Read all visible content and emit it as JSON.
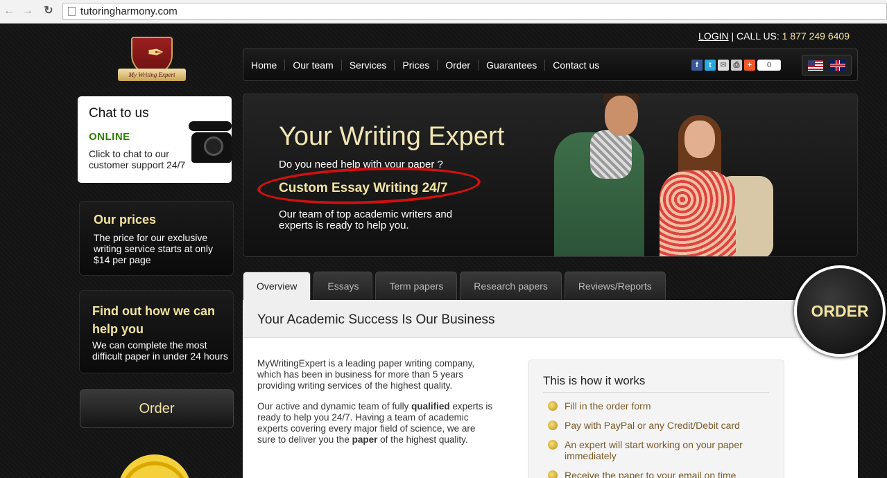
{
  "browser": {
    "url": "tutoringharmony.com"
  },
  "topbar": {
    "login": "LOGIN",
    "separator": "|",
    "call_label": "CALL US:",
    "phone": "1 877 249 6409"
  },
  "logo": {
    "text": "My Writing Expert"
  },
  "nav": {
    "items": [
      "Home",
      "Our team",
      "Services",
      "Prices",
      "Order",
      "Guarantees",
      "Contact us"
    ],
    "share_count": "0"
  },
  "chat": {
    "title": "Chat to us",
    "status": "ONLINE",
    "desc": "Click to chat to our customer support 24/7"
  },
  "prices": {
    "heading": "Our prices",
    "text": "The price for our exclusive writing service starts at only $14 per page"
  },
  "findout": {
    "heading": "Find out how we can help you",
    "text": "We can complete the most difficult paper in under 24 hours"
  },
  "side_order": {
    "label": "Order"
  },
  "hero": {
    "title": "Your Writing Expert",
    "question": "Do you need help with your paper ?",
    "tagline": "Custom Essay Writing 24/7",
    "team_text": "Our team of top academic writers and experts is ready to help you."
  },
  "tabs": [
    "Overview",
    "Essays",
    "Term papers",
    "Research papers",
    "Reviews/Reports"
  ],
  "content": {
    "heading": "Your Academic Success Is Our Business",
    "p1": "MyWritingExpert is a leading paper writing company, which has been in business for more than 5 years providing writing services of the highest quality.",
    "p2_a": "Our active and dynamic team of fully ",
    "p2_b": "qualified",
    "p2_c": " experts is ready to help you 24/7. Having a team of academic experts covering every major field of science, we are sure to deliver you the ",
    "p2_d": "paper",
    "p2_e": " of the highest quality."
  },
  "how": {
    "heading": "This is how it works",
    "steps": [
      "Fill in the order form",
      "Pay with PayPal or any Credit/Debit card",
      "An expert will start working on your paper immediately",
      "Receive the paper to your email on time"
    ]
  },
  "order_circle": {
    "label": "ORDER"
  },
  "colors": {
    "accent_gold": "#f3e5a0",
    "online_green": "#2f7d00",
    "highlight_red": "#d01010"
  }
}
